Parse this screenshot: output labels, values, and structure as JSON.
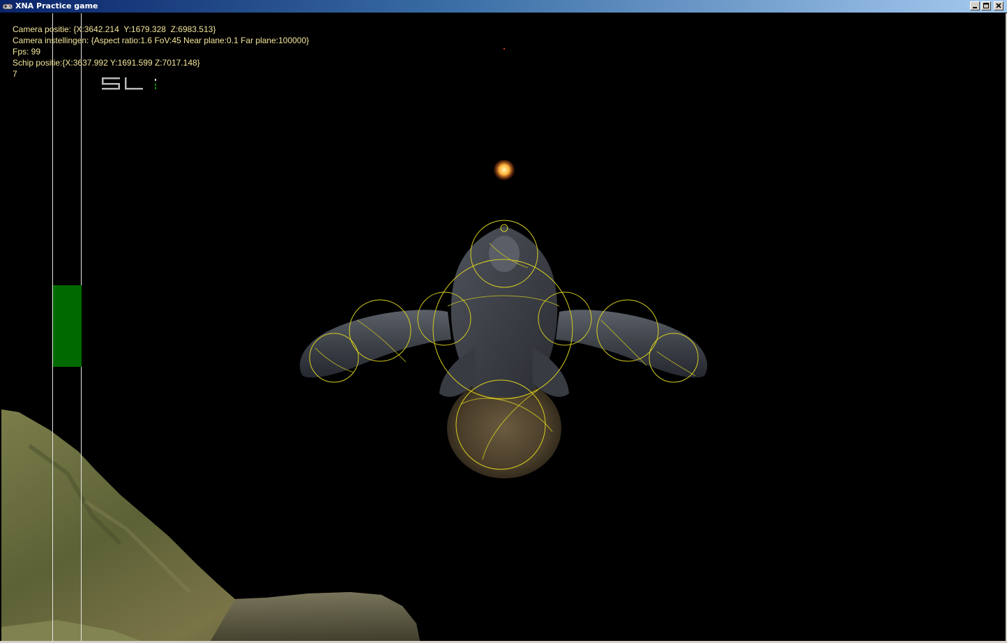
{
  "window": {
    "title": "XNA Practice game",
    "icon": "gamepad-icon",
    "buttons": {
      "minimize": "minimize-icon",
      "maximize": "maximize-icon",
      "close": "close-icon"
    }
  },
  "hud": {
    "camera_position": "Camera positie: {X:3642.214  Y:1679.328  Z:6983.513}",
    "camera_settings": "Camera instellingen: {Aspect ratio:1.6 FoV:45 Near plane:0.1 Far plane:100000}",
    "fps": "Fps: 99",
    "ship_position": "Schip positie:{X:3637.992 Y:1691.599 Z:7017.148}",
    "counter": "7",
    "logo_text": "SL"
  },
  "gauge": {
    "level": 0.13,
    "color": "#006a00"
  },
  "colors": {
    "hud_text": "#f4e79a",
    "bounding_spheres": "#d8d020",
    "sun": "#ff8a20",
    "terrain": "#6b6a3a"
  }
}
